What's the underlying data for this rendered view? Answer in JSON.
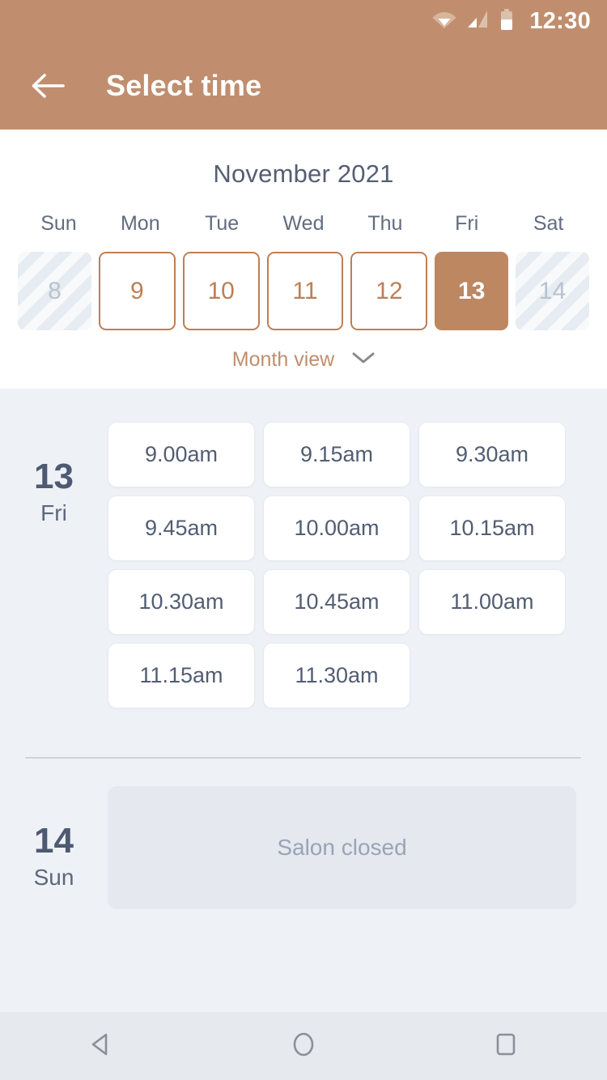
{
  "statusbar": {
    "time": "12:30",
    "icons": [
      "wifi-icon",
      "cell-signal-icon",
      "battery-icon"
    ]
  },
  "appbar": {
    "back_icon": "back-arrow-icon",
    "title": "Select time"
  },
  "calendar": {
    "month_title": "November 2021",
    "weekdays": [
      "Sun",
      "Mon",
      "Tue",
      "Wed",
      "Thu",
      "Fri",
      "Sat"
    ],
    "days": [
      {
        "num": "8",
        "state": "disabled"
      },
      {
        "num": "9",
        "state": "available"
      },
      {
        "num": "10",
        "state": "available"
      },
      {
        "num": "11",
        "state": "available"
      },
      {
        "num": "12",
        "state": "available"
      },
      {
        "num": "13",
        "state": "selected"
      },
      {
        "num": "14",
        "state": "disabled"
      }
    ],
    "month_view_label": "Month view",
    "month_view_icon": "chevron-down-icon"
  },
  "schedule": [
    {
      "day_number": "13",
      "day_of_week": "Fri",
      "slots": [
        "9.00am",
        "9.15am",
        "9.30am",
        "9.45am",
        "10.00am",
        "10.15am",
        "10.30am",
        "10.45am",
        "11.00am",
        "11.15am",
        "11.30am"
      ]
    },
    {
      "day_number": "14",
      "day_of_week": "Sun",
      "closed_label": "Salon closed"
    }
  ],
  "navbar": {
    "back_icon": "android-back-icon",
    "home_icon": "android-home-icon",
    "recents_icon": "android-recents-icon"
  },
  "colors": {
    "brand": "#c08e6e",
    "brand_dark": "#bd7f56",
    "selected_day": "#bd8761",
    "page_bg": "#eef1f6",
    "text_dark": "#4e5a72",
    "text_muted": "#9aa4b5"
  }
}
